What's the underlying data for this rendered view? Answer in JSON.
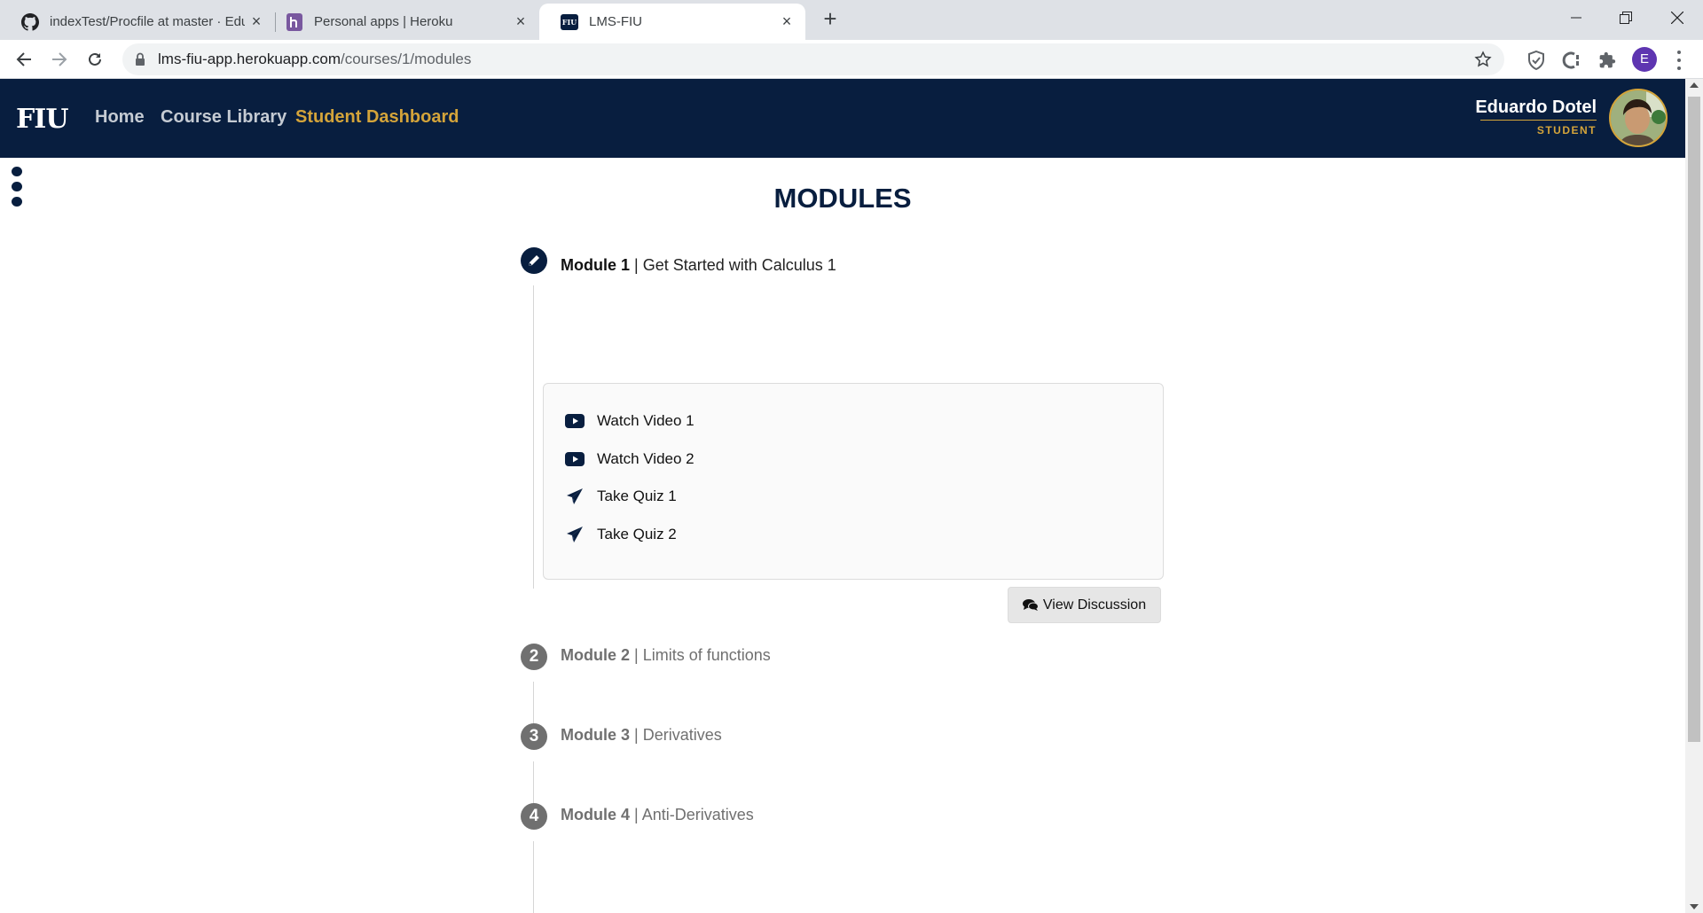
{
  "browser": {
    "tabs": [
      {
        "title": "indexTest/Procfile at master · Edu",
        "icon": "github-icon"
      },
      {
        "title": "Personal apps | Heroku",
        "icon": "heroku-icon"
      },
      {
        "title": "LMS-FIU",
        "icon": "fiu-icon",
        "favicon_text": "FIU"
      }
    ],
    "url_host": "lms-fiu-app.herokuapp.com",
    "url_path": "/courses/1/modules",
    "profile_initial": "E"
  },
  "app": {
    "logo": "FIU",
    "nav": [
      {
        "label": "Home"
      },
      {
        "label": "Course Library"
      },
      {
        "label": "Student Dashboard"
      }
    ],
    "user": {
      "name": "Eduardo Dotel",
      "role": "STUDENT"
    },
    "colors": {
      "navy": "#081e3f",
      "gold": "#d4a43a"
    }
  },
  "page": {
    "title": "MODULES",
    "modules": [
      {
        "label": "Module 1",
        "separator": " | ",
        "name": "Get Started with Calculus 1",
        "badge": "pencil-icon",
        "status": "current"
      },
      {
        "label": "Module 2",
        "separator": " | ",
        "name": "Limits of functions",
        "badge": "2",
        "status": "locked"
      },
      {
        "label": "Module 3",
        "separator": " | ",
        "name": "Derivatives",
        "badge": "3",
        "status": "locked"
      },
      {
        "label": "Module 4",
        "separator": " | ",
        "name": "Anti-Derivatives",
        "badge": "4",
        "status": "locked"
      }
    ],
    "items": [
      {
        "label": "Watch Video 1",
        "icon": "youtube-icon"
      },
      {
        "label": "Watch Video 2",
        "icon": "youtube-icon"
      },
      {
        "label": "Take Quiz 1",
        "icon": "paper-plane-icon"
      },
      {
        "label": "Take Quiz 2",
        "icon": "paper-plane-icon"
      }
    ],
    "discussion_button": "View Discussion"
  }
}
